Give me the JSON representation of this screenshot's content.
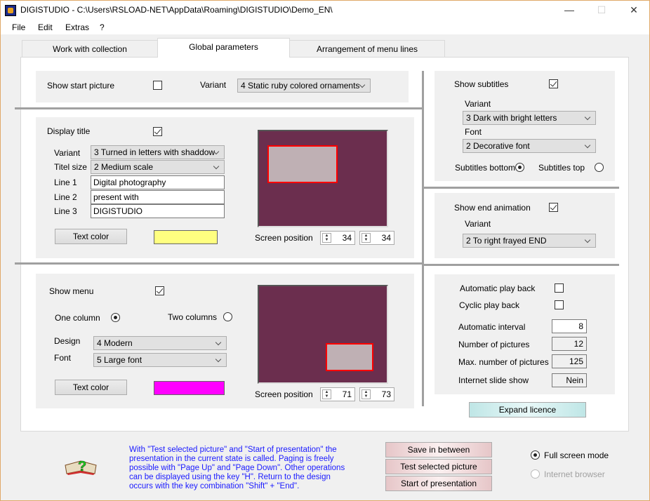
{
  "window": {
    "title": "DIGISTUDIO - C:\\Users\\RSLOAD-NET\\AppData\\Roaming\\DIGISTUDIO\\Demo_EN\\",
    "minimize": "—",
    "maximize": "☐",
    "close": "✕"
  },
  "menu": [
    "File",
    "Edit",
    "Extras",
    "?"
  ],
  "tabs": [
    "Work with collection",
    "Global parameters",
    "Arrangement of menu lines"
  ],
  "start": {
    "label": "Show start picture",
    "checked": false,
    "variant_label": "Variant",
    "variant": "4 Static ruby colored ornaments"
  },
  "title_section": {
    "label": "Display title",
    "checked": true,
    "variant_label": "Variant",
    "variant": "3 Turned in letters with shaddow",
    "size_label": "Titel size",
    "size": "2 Medium scale",
    "line1_label": "Line 1",
    "line1": "Digital photography",
    "line2_label": "Line 2",
    "line2": "present with",
    "line3_label": "Line 3",
    "line3": "DIGISTUDIO",
    "text_color_button": "Text color",
    "text_color": "#ffff80",
    "screen_position_label": "Screen position",
    "pos_x": "34",
    "pos_y": "34"
  },
  "menu_section": {
    "label": "Show menu",
    "checked": true,
    "one_column": "One column",
    "two_columns": "Two columns",
    "layout": "one",
    "design_label": "Design",
    "design": "4 Modern",
    "font_label": "Font",
    "font": "5 Large font",
    "text_color_button": "Text color",
    "text_color": "#ff00ff",
    "screen_position_label": "Screen position",
    "pos_x": "71",
    "pos_y": "73"
  },
  "subtitles": {
    "label": "Show subtitles",
    "checked": true,
    "variant_label": "Variant",
    "variant": "3 Dark with bright letters",
    "font_label": "Font",
    "font": "2 Decorative font",
    "bottom": "Subtitles bottom",
    "top": "Subtitles top",
    "position": "bottom"
  },
  "end_animation": {
    "label": "Show end animation",
    "checked": true,
    "variant_label": "Variant",
    "variant": "2 To right frayed END"
  },
  "playback": {
    "auto_label": "Automatic play back",
    "auto": false,
    "cyclic_label": "Cyclic play back",
    "cyclic": false,
    "interval_label": "Automatic interval",
    "interval": "8",
    "count_label": "Number of pictures",
    "count": "12",
    "max_label": "Max. number of pictures",
    "max": "125",
    "internet_label": "Internet slide show",
    "internet": "Nein"
  },
  "expand_licence": "Expand licence",
  "help_text": "With \"Test selected picture\" and \"Start of presentation\" the presentation in the current state is called. Paging is freely possible with \"Page Up\" and \"Page Down\". Other operations can be displayed using the key \"H\". Return to the design occurs with the key combination \"Shift\" + \"End\".",
  "buttons": {
    "save": "Save in between",
    "test": "Test selected picture",
    "start": "Start of presentation"
  },
  "mode": {
    "fullscreen": "Full screen mode",
    "browser": "Internet browser",
    "selected": "fullscreen"
  }
}
